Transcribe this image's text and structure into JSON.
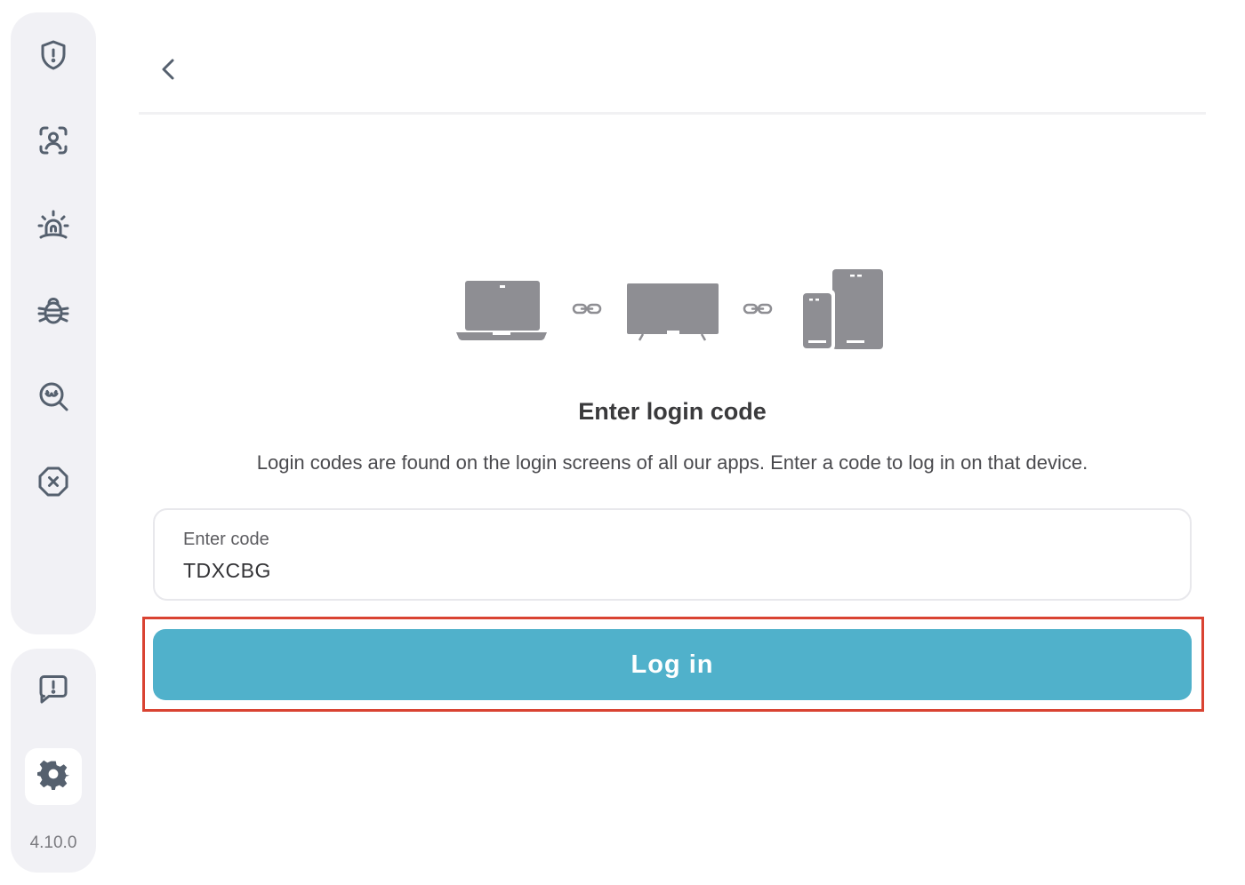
{
  "app": {
    "version": "4.10.0"
  },
  "sidebar": {
    "items": [
      {
        "icon": "shield-alert-icon"
      },
      {
        "icon": "face-scan-icon"
      },
      {
        "icon": "alarm-siren-icon"
      },
      {
        "icon": "bug-icon"
      },
      {
        "icon": "search-tracker-icon"
      },
      {
        "icon": "block-octagon-icon"
      }
    ],
    "bottom_items": [
      {
        "icon": "feedback-icon"
      },
      {
        "icon": "gear-icon",
        "active": true
      }
    ]
  },
  "main": {
    "title": "Enter login code",
    "description": "Login codes are found on the login screens of all our apps. Enter a code to log in on that device.",
    "code_field": {
      "label": "Enter code",
      "value": "TDXCBG"
    },
    "login_button": "Log in"
  },
  "colors": {
    "accent": "#50b1cb",
    "highlight": "#d94332",
    "sidebar_bg": "#f1f1f5",
    "icon": "#55606e",
    "device_gray": "#8e8e93"
  }
}
